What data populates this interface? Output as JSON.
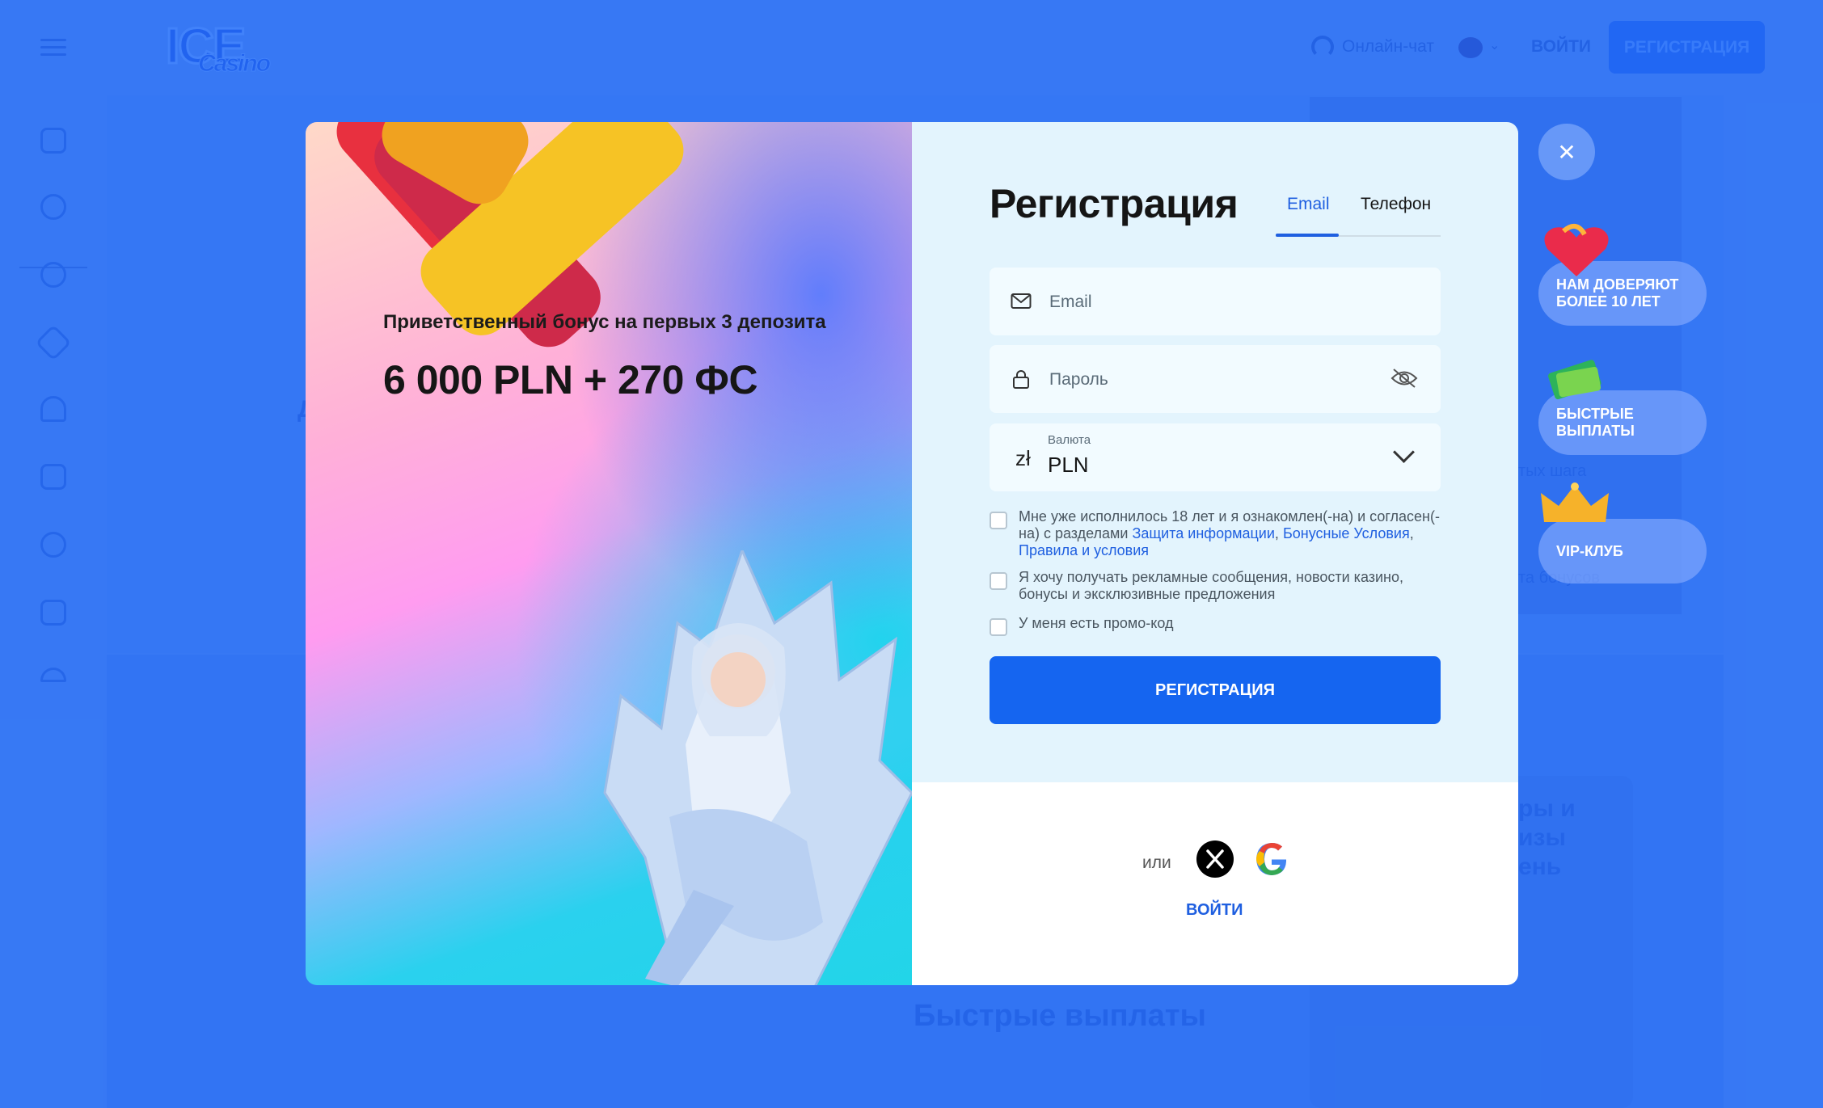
{
  "header": {
    "logo_text": "ICE",
    "logo_sub": "Casino",
    "chat_label": "Онлайн-чат",
    "login_label": "ВОЙТИ",
    "register_label": "РЕГИСТРАЦИЯ"
  },
  "background": {
    "fast_payouts_heading": "Быстрые выплаты",
    "steps_fragment": "тых шага",
    "bonus_fragment": "та бонусов",
    "prizes_fragment_1": "ры и",
    "prizes_fragment_2": "изы",
    "prizes_fragment_3": "ень",
    "left_fragment": "Д"
  },
  "promo": {
    "subtitle": "Приветственный бонус на первых 3 депозита",
    "title": "6 000 PLN + 270 ФС"
  },
  "form": {
    "title": "Регистрация",
    "tabs": [
      {
        "label": "Email",
        "active": true
      },
      {
        "label": "Телефон",
        "active": false
      }
    ],
    "email_placeholder": "Email",
    "password_placeholder": "Пароль",
    "currency": {
      "label": "Валюта",
      "value": "PLN",
      "symbol": "zł"
    },
    "checks": {
      "terms_prefix": "Мне уже исполнилось 18 лет и я ознакомлен(-на) и согласен(-на) с разделами ",
      "link_privacy": "Защита информации",
      "sep1": ", ",
      "link_bonus": "Бонусные Условия",
      "sep2": ", ",
      "link_rules": "Правила и условия",
      "marketing": "Я хочу получать рекламные сообщения, новости казино, бонусы и эксклюзивные предложения",
      "promo": "У меня есть промо-код"
    },
    "register_button": "РЕГИСТРАЦИЯ",
    "or_label": "или",
    "login_link": "ВОЙТИ"
  },
  "badges": [
    {
      "label": "НАМ ДОВЕРЯЮТ БОЛЕЕ 10 ЛЕТ",
      "icon": "heart-icon"
    },
    {
      "label": "БЫСТРЫЕ ВЫПЛАТЫ",
      "icon": "cash-icon"
    },
    {
      "label": "VIP-КЛУБ",
      "icon": "crown-icon"
    }
  ],
  "colors": {
    "primary": "#1565f0",
    "form_bg": "#e3f4fd",
    "backdrop": "#4a86f2"
  }
}
